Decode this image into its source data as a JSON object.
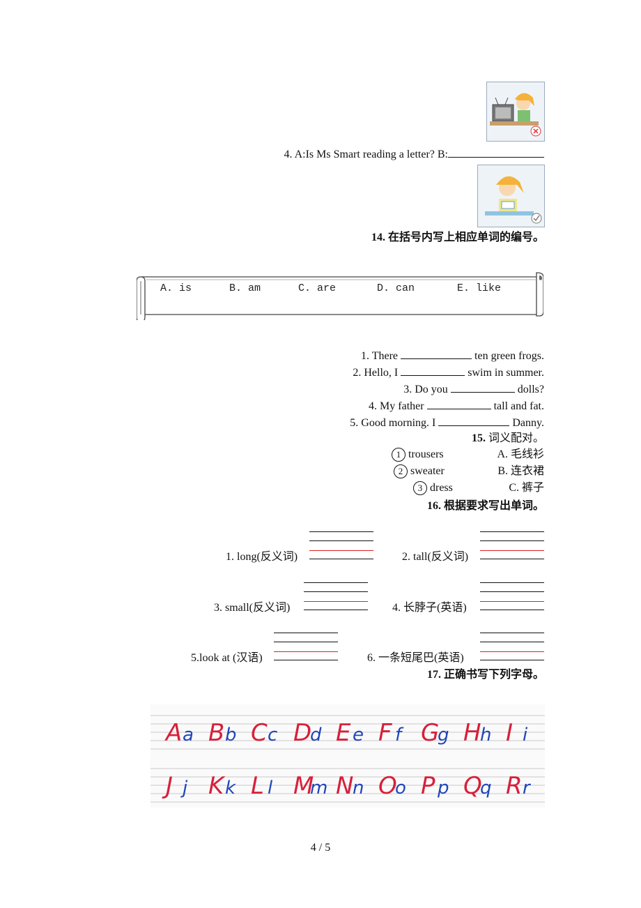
{
  "q13_item4": {
    "text": "4. A:Is Ms Smart reading a letter?   B:"
  },
  "q14": {
    "number": "14.",
    "title": "在括号内写上相应单词的编号。",
    "options": [
      "A. is",
      "B. am",
      "C. are",
      "D. can",
      "E. like"
    ],
    "sentences": [
      {
        "before": "1. There ",
        "after": " ten green frogs."
      },
      {
        "before": "2. Hello, I ",
        "after": " swim in summer."
      },
      {
        "before": "3. Do you ",
        "after": " dolls?"
      },
      {
        "before": "4. My father ",
        "after": " tall and fat."
      },
      {
        "before": "5. Good morning. I ",
        "after": " Danny."
      }
    ]
  },
  "q15": {
    "number": "15.",
    "title": "词义配对。",
    "left": [
      {
        "num": "1",
        "word": "trousers"
      },
      {
        "num": "2",
        "word": "sweater"
      },
      {
        "num": "3",
        "word": "dress"
      }
    ],
    "right": [
      "A. 毛线衫",
      "B. 连衣裙",
      "C. 裤子"
    ]
  },
  "q16": {
    "number": "16.",
    "title": "根据要求写出单词。",
    "items": [
      "1. long(反义词)",
      "2. tall(反义词)",
      "3. small(反义词)",
      "4. 长脖子(英语)",
      "5.look at (汉语)",
      "6. 一条短尾巴(英语)"
    ]
  },
  "q17": {
    "number": "17.",
    "title": "正确书写下列字母。",
    "row1": [
      [
        "A",
        "a"
      ],
      [
        "B",
        "b"
      ],
      [
        "C",
        "c"
      ],
      [
        "D",
        "d"
      ],
      [
        "E",
        "e"
      ],
      [
        "F",
        "f"
      ],
      [
        "G",
        "g"
      ],
      [
        "H",
        "h"
      ],
      [
        "I",
        "i"
      ]
    ],
    "row2": [
      [
        "J",
        "j"
      ],
      [
        "K",
        "k"
      ],
      [
        "L",
        "l"
      ],
      [
        "M",
        "m"
      ],
      [
        "N",
        "n"
      ],
      [
        "O",
        "o"
      ],
      [
        "P",
        "p"
      ],
      [
        "Q",
        "q"
      ],
      [
        "R",
        "r"
      ]
    ],
    "colors": {
      "upper": "#d8203a",
      "lower": "#2046b8",
      "guide": "#c9c9c9"
    }
  },
  "icons": {
    "picture1": "girl-tv-cross-icon",
    "picture2": "girl-letter-check-icon"
  },
  "footer": {
    "page": "4 / 5"
  }
}
